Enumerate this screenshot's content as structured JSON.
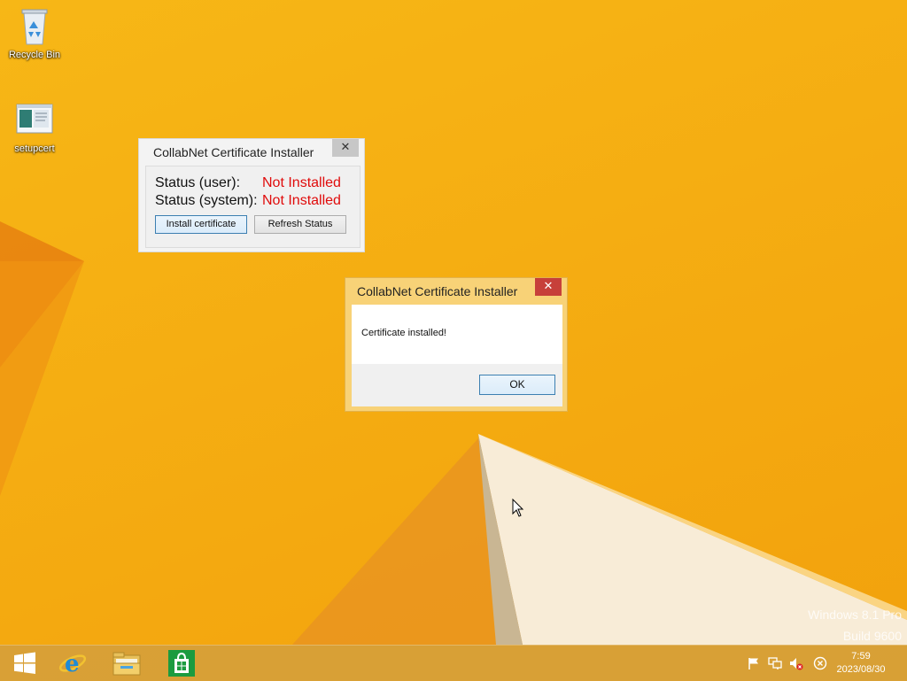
{
  "desktop": {
    "icons": [
      {
        "label": "Recycle Bin",
        "icon": "recycle-bin-icon"
      },
      {
        "label": "setupcert",
        "icon": "executable-icon"
      }
    ],
    "watermark": {
      "line1": "Windows 8.1 Pro",
      "line2": "Build 9600"
    }
  },
  "installer_window": {
    "title": "CollabNet Certificate Installer",
    "close_glyph": "✕",
    "status_user_label": "Status (user):",
    "status_user_value": "Not Installed",
    "status_system_label": "Status (system):",
    "status_system_value": "Not Installed",
    "install_button": "Install certificate",
    "refresh_button": "Refresh Status"
  },
  "message_box": {
    "title": "CollabNet Certificate Installer",
    "close_glyph": "✕",
    "message": "Certificate installed!",
    "ok_button": "OK"
  },
  "taskbar": {
    "items": [
      "windows-start-icon",
      "internet-explorer-icon",
      "file-explorer-icon",
      "windows-store-icon"
    ],
    "tray": [
      "action-center-flag-icon",
      "network-icon",
      "volume-muted-icon",
      "close-circle-icon"
    ],
    "clock_time": "7:59",
    "clock_date": "2023/08/30"
  },
  "colors": {
    "desktop": "#f5ad12",
    "status_red": "#e00b0b",
    "close_red": "#c7403a",
    "taskbar": "#d6a03a"
  }
}
